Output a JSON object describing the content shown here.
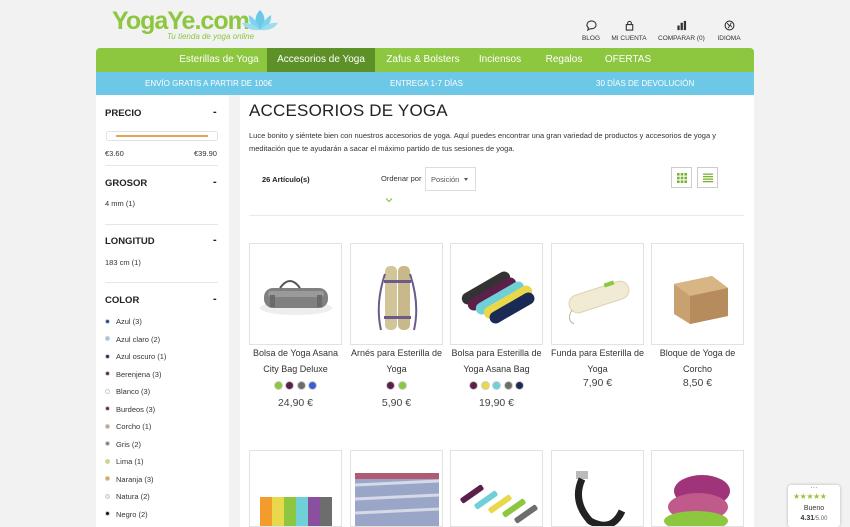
{
  "logo": {
    "brand": "YogaYe.com",
    "tagline": "Tu tienda de yoga online"
  },
  "header_links": [
    {
      "label": "BLOG",
      "icon": "chat-bubble-icon"
    },
    {
      "label": "MI CUENTA",
      "icon": "lock-icon"
    },
    {
      "label": "COMPARAR (0)",
      "icon": "bar-chart-icon"
    },
    {
      "label": "IDIOMA",
      "icon": "globe-icon"
    }
  ],
  "nav": [
    {
      "label": "Esterillas de Yoga",
      "active": false
    },
    {
      "label": "Accesorios de Yoga",
      "active": true
    },
    {
      "label": "Zafus & Bolsters",
      "active": false
    },
    {
      "label": "Inciensos",
      "active": false
    },
    {
      "label": "Regalos",
      "active": false
    },
    {
      "label": "OFERTAS",
      "active": false
    }
  ],
  "info_bar": [
    "ENVÍO GRATIS A PARTIR DE 100€",
    "ENTREGA 1-7 DÍAS",
    "30 DÍAS DE DEVOLUCIÓN"
  ],
  "sidebar": {
    "price": {
      "title": "PRECIO",
      "min": "€3.60",
      "max": "€39.90"
    },
    "grosor": {
      "title": "GROSOR",
      "options": [
        "4 mm (1)"
      ]
    },
    "longitud": {
      "title": "LONGITUD",
      "options": [
        "183 cm (1)"
      ]
    },
    "color": {
      "title": "COLOR",
      "options": [
        {
          "label": "Azul (3)",
          "color": "#1f3f99"
        },
        {
          "label": "Azul claro (2)",
          "color": "#9ec6ef"
        },
        {
          "label": "Azul oscuro (1)",
          "color": "#1b2a55"
        },
        {
          "label": "Berenjena (3)",
          "color": "#5b1f4a"
        },
        {
          "label": "Blanco (3)",
          "color": "#ffffff"
        },
        {
          "label": "Burdeos (3)",
          "color": "#7a1f2b"
        },
        {
          "label": "Corcho (1)",
          "color": "#c9a171"
        },
        {
          "label": "Gris (2)",
          "color": "#808080"
        },
        {
          "label": "Lima (1)",
          "color": "#d8e04a"
        },
        {
          "label": "Naranja (3)",
          "color": "#f39c2c"
        },
        {
          "label": "Natura (2)",
          "color": "#f3ecd8"
        },
        {
          "label": "Negro (2)",
          "color": "#111111"
        }
      ]
    },
    "collapse_symbol": "-"
  },
  "main": {
    "title": "ACCESORIOS DE YOGA",
    "description": "Luce bonito y siéntete bien con nuestros accesorios de yoga. Aquí puedes encontrar una gran variedad de productos y accesorios de yoga y meditación que te ayudarán a sacar el máximo partido de tus sesiones de yoga.",
    "count": "26 Artículo(s)",
    "sort_label": "Ordenar por",
    "sort_value": "Posición"
  },
  "products": [
    {
      "name": "Bolsa de Yoga Asana City Bag Deluxe",
      "price": "24,90 €",
      "colors": [
        "#8dc63f",
        "#5b1f4a",
        "#6d6d6d",
        "#3a5fd0"
      ]
    },
    {
      "name": "Arnés para Esterilla de Yoga",
      "price": "5,90 €",
      "colors": [
        "#5b1f4a",
        "#8dc63f"
      ]
    },
    {
      "name": "Bolsa para Esterilla de Yoga Asana Bag",
      "price": "19,90 €",
      "colors": [
        "#5b1f4a",
        "#e8d84a",
        "#6fd0d8",
        "#6d6d6d",
        "#1b2a55"
      ]
    },
    {
      "name": "Funda para Esterilla de Yoga",
      "price": "7,90 €",
      "colors": []
    },
    {
      "name": "Bloque de Yoga de Corcho",
      "price": "8,50 €",
      "colors": []
    }
  ],
  "rating": {
    "more": "···",
    "stars": "★★★★★",
    "label": "Bueno",
    "score": "4.31",
    "max": "/5.00"
  }
}
